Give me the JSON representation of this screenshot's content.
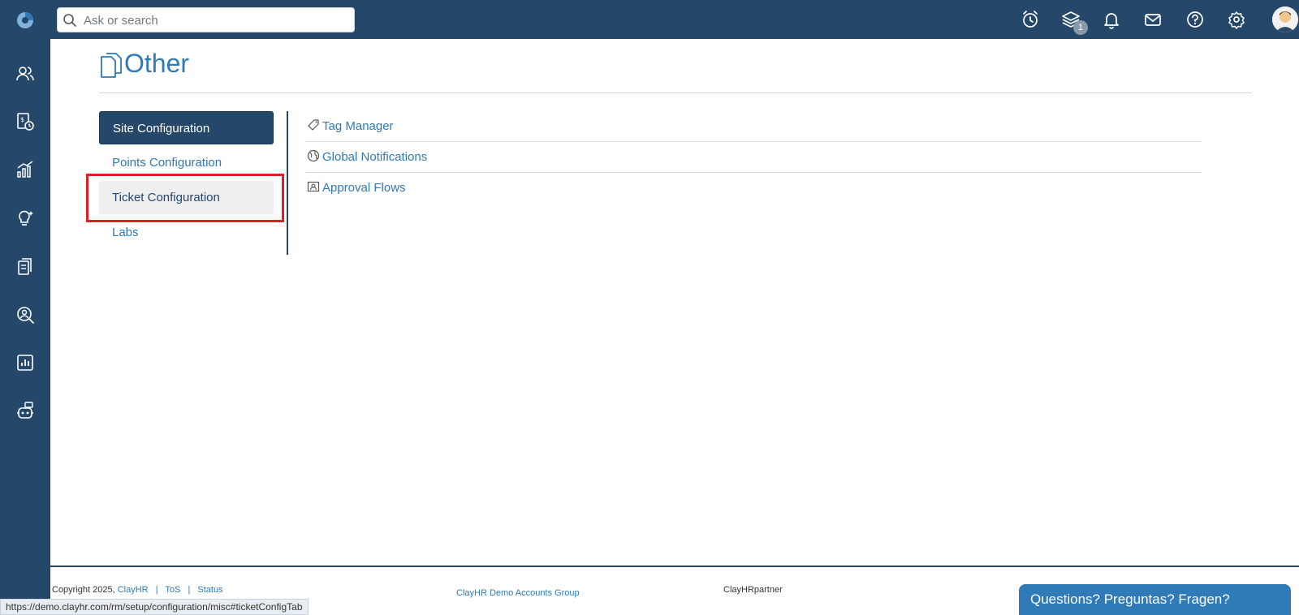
{
  "search": {
    "placeholder": "Ask or search"
  },
  "notifications": {
    "layers_badge": "1"
  },
  "page": {
    "title": "Other"
  },
  "left_menu": {
    "items": [
      {
        "label": "Site Configuration",
        "state": "active"
      },
      {
        "label": "Points Configuration",
        "state": "normal"
      },
      {
        "label": "Ticket Configuration",
        "state": "hover"
      },
      {
        "label": "Labs",
        "state": "normal"
      }
    ]
  },
  "right_list": {
    "items": [
      {
        "label": "Tag Manager",
        "icon": "tag-icon"
      },
      {
        "label": "Global Notifications",
        "icon": "globe-icon"
      },
      {
        "label": "Approval Flows",
        "icon": "user-card-icon"
      }
    ]
  },
  "footer": {
    "copyright": "Copyright 2025,",
    "company_link": "ClayHR",
    "tos": "ToS",
    "status": "Status",
    "group": "ClayHR Demo Accounts Group",
    "partner": "ClayHRpartner"
  },
  "status_bar": {
    "url": "https://demo.clayhr.com/rm/setup/configuration/misc#ticketConfigTab"
  },
  "chat": {
    "label": "Questions? Preguntas? Fragen?"
  },
  "colors": {
    "navy": "#25476a",
    "link_blue": "#2f7ab7",
    "highlight_red": "#e02020"
  }
}
